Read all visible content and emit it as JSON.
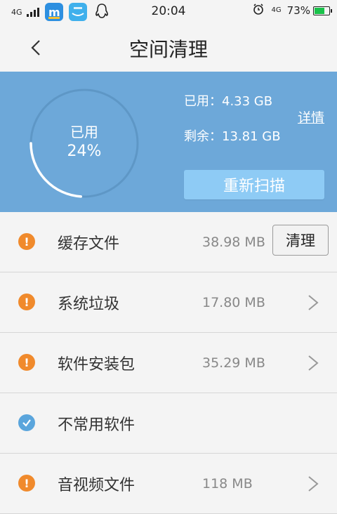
{
  "status_bar": {
    "network_left": "4G",
    "time": "20:04",
    "network_right": "4G",
    "battery_percent_text": "73%",
    "battery_level": 0.73,
    "battery_color": "#19c24a"
  },
  "header": {
    "title": "空间清理"
  },
  "storage": {
    "ring_label": "已用",
    "ring_percent": "24%",
    "used_fraction": 0.24,
    "used_text": "已用：4.33 GB",
    "free_text": "剩余：13.81 GB",
    "details_link": "详情",
    "rescan_label": "重新扫描",
    "panel_color": "#6da8d9",
    "button_color": "#8ecbf5"
  },
  "items": [
    {
      "name": "缓存文件",
      "size": "38.98 MB",
      "status": "warning",
      "action": "清理"
    },
    {
      "name": "系统垃圾",
      "size": "17.80 MB",
      "status": "warning"
    },
    {
      "name": "软件安装包",
      "size": "35.29 MB",
      "status": "warning"
    },
    {
      "name": "不常用软件",
      "status": "ok"
    },
    {
      "name": "音视频文件",
      "size": "118 MB",
      "status": "warning"
    }
  ],
  "colors": {
    "warning": "#f08a2c",
    "ok": "#5aa5dc"
  },
  "icons": {
    "warning": "exclamation-icon",
    "ok": "check-icon",
    "chevron": "chevron-right-icon",
    "back": "back-arrow-icon"
  }
}
